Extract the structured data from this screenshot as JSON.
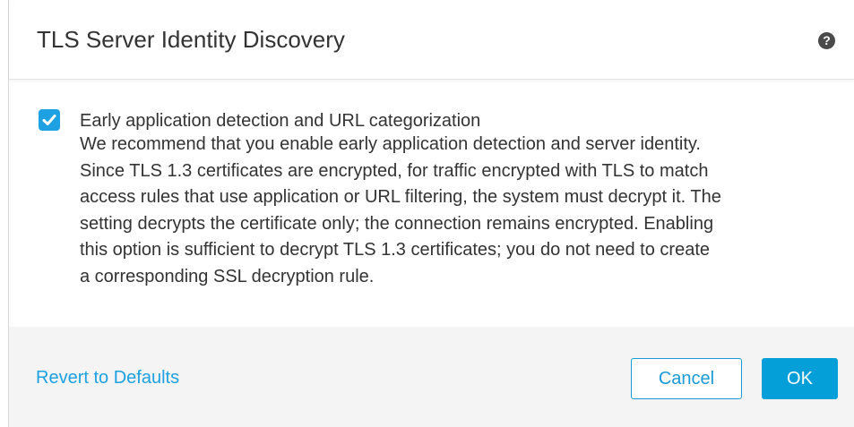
{
  "dialog": {
    "title": "TLS Server Identity Discovery",
    "help_icon": "question-mark-icon",
    "help_glyph": "?"
  },
  "option": {
    "checked": true,
    "label": "Early application detection and URL categorization",
    "description_lines": [
      "We recommend that you enable early application detection and server identity.",
      "Since TLS 1.3 certificates are encrypted, for traffic encrypted with TLS to match",
      "access rules that use application or URL filtering, the system must decrypt it. The",
      "setting decrypts the certificate only; the connection remains encrypted. Enabling",
      "this option is sufficient to decrypt TLS 1.3 certificates; you do not need to create",
      "a corresponding SSL decryption rule."
    ]
  },
  "footer": {
    "revert_label": "Revert to Defaults",
    "cancel_label": "Cancel",
    "ok_label": "OK"
  },
  "colors": {
    "accent": "#1da1e2",
    "primary_button": "#049fd9",
    "footer_bg": "#f4f4f4",
    "text": "#333333"
  }
}
